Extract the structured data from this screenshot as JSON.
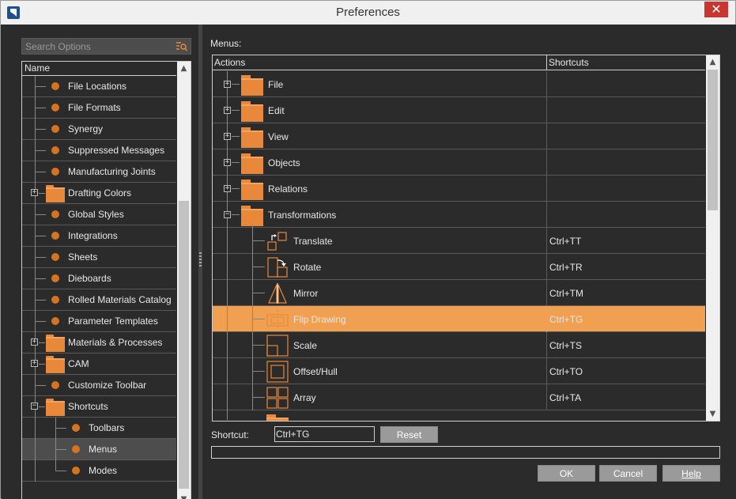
{
  "window": {
    "title": "Preferences",
    "close_glyph": "✕"
  },
  "search": {
    "placeholder": "Search Options",
    "icon": "search-filter-icon"
  },
  "tree": {
    "header": "Name",
    "items": [
      {
        "label": "File Locations",
        "kind": "leaf",
        "level": 1
      },
      {
        "label": "File Formats",
        "kind": "leaf",
        "level": 1
      },
      {
        "label": "Synergy",
        "kind": "leaf",
        "level": 1
      },
      {
        "label": "Suppressed Messages",
        "kind": "leaf",
        "level": 1
      },
      {
        "label": "Manufacturing Joints",
        "kind": "leaf",
        "level": 1
      },
      {
        "label": "Drafting Colors",
        "kind": "folder",
        "level": 1,
        "expander": "+"
      },
      {
        "label": "Global Styles",
        "kind": "leaf",
        "level": 1
      },
      {
        "label": "Integrations",
        "kind": "leaf",
        "level": 1
      },
      {
        "label": "Sheets",
        "kind": "leaf",
        "level": 1
      },
      {
        "label": "Dieboards",
        "kind": "leaf",
        "level": 1
      },
      {
        "label": "Rolled Materials Catalog",
        "kind": "leaf",
        "level": 1
      },
      {
        "label": "Parameter Templates",
        "kind": "leaf",
        "level": 1
      },
      {
        "label": "Materials & Processes",
        "kind": "folder",
        "level": 1,
        "expander": "+"
      },
      {
        "label": "CAM",
        "kind": "folder",
        "level": 1,
        "expander": "+"
      },
      {
        "label": "Customize Toolbar",
        "kind": "leaf",
        "level": 1
      },
      {
        "label": "Shortcuts",
        "kind": "folder",
        "level": 1,
        "expander": "−"
      },
      {
        "label": "Toolbars",
        "kind": "leaf",
        "level": 2
      },
      {
        "label": "Menus",
        "kind": "leaf",
        "level": 2,
        "selected": true
      },
      {
        "label": "Modes",
        "kind": "leaf",
        "level": 2
      }
    ]
  },
  "menus": {
    "label": "Menus:",
    "columns": {
      "actions": "Actions",
      "shortcuts": "Shortcuts"
    },
    "rows": [
      {
        "label": "File",
        "kind": "folder",
        "expander": "+",
        "shortcut": ""
      },
      {
        "label": "Edit",
        "kind": "folder",
        "expander": "+",
        "shortcut": ""
      },
      {
        "label": "View",
        "kind": "folder",
        "expander": "+",
        "shortcut": ""
      },
      {
        "label": "Objects",
        "kind": "folder",
        "expander": "+",
        "shortcut": ""
      },
      {
        "label": "Relations",
        "kind": "folder",
        "expander": "+",
        "shortcut": ""
      },
      {
        "label": "Transformations",
        "kind": "folder",
        "expander": "−",
        "shortcut": ""
      },
      {
        "label": "Translate",
        "kind": "action",
        "icon": "translate-icon",
        "shortcut": "Ctrl+TT"
      },
      {
        "label": "Rotate",
        "kind": "action",
        "icon": "rotate-icon",
        "shortcut": "Ctrl+TR"
      },
      {
        "label": "Mirror",
        "kind": "action",
        "icon": "mirror-icon",
        "shortcut": "Ctrl+TM"
      },
      {
        "label": "Flip Drawing",
        "kind": "action",
        "icon": "flip-drawing-icon",
        "shortcut": "Ctrl+TG",
        "selected": true
      },
      {
        "label": "Scale",
        "kind": "action",
        "icon": "scale-icon",
        "shortcut": "Ctrl+TS"
      },
      {
        "label": "Offset/Hull",
        "kind": "action",
        "icon": "offset-hull-icon",
        "shortcut": "Ctrl+TO"
      },
      {
        "label": "Array",
        "kind": "action",
        "icon": "array-icon",
        "shortcut": "Ctrl+TA"
      }
    ]
  },
  "shortcut": {
    "label": "Shortcut:",
    "value": "Ctrl+TG",
    "reset": "Reset"
  },
  "buttons": {
    "ok": "OK",
    "cancel": "Cancel",
    "help": "Help"
  },
  "colors": {
    "accent": "#f0a050",
    "folder": "#e8883a",
    "bullet": "#d6731e",
    "background": "#2b2b2b"
  }
}
